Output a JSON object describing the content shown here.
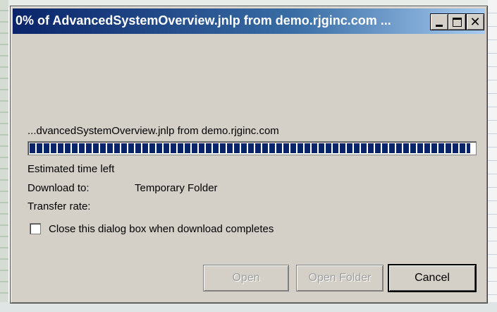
{
  "dialog": {
    "title": "0% of AdvancedSystemOverview.jnlp from demo.rjginc.com ...",
    "file_source": "...dvancedSystemOverview.jnlp from demo.rjginc.com",
    "progress_fraction": 0.99,
    "estimated_time_label": "Estimated time left",
    "download_to_label": "Download to:",
    "download_to_value": "Temporary Folder",
    "transfer_rate_label": "Transfer rate:",
    "close_when_done_label": "Close this dialog box when download completes",
    "close_when_done_checked": false,
    "buttons": {
      "open": "Open",
      "open_folder": "Open Folder",
      "cancel": "Cancel"
    },
    "window_buttons": {
      "close_glyph": "✕"
    }
  }
}
